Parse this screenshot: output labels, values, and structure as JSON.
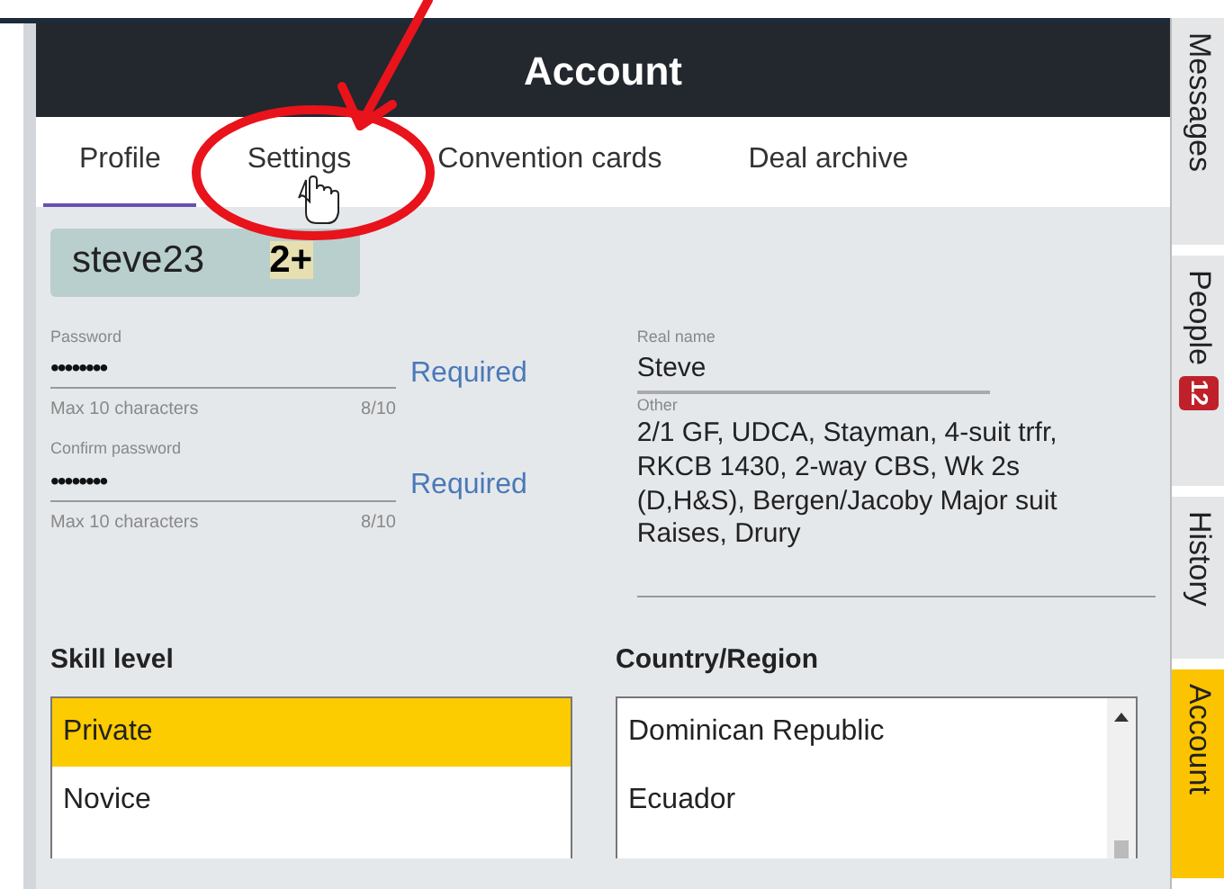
{
  "header": {
    "title": "Account"
  },
  "tabs": [
    {
      "label": "Profile",
      "selected": true
    },
    {
      "label": "Settings",
      "selected": false
    },
    {
      "label": "Convention cards",
      "selected": false
    },
    {
      "label": "Deal archive",
      "selected": false
    }
  ],
  "user": {
    "username": "steve23",
    "rank": "2+"
  },
  "password_fields": [
    {
      "label": "Password",
      "value": "••••••••",
      "hint": "Max 10 characters",
      "counter": "8/10",
      "status": "Required"
    },
    {
      "label": "Confirm password",
      "value": "••••••••",
      "hint": "Max 10 characters",
      "counter": "8/10",
      "status": "Required"
    }
  ],
  "real_name": {
    "label": "Real name",
    "value": "Steve"
  },
  "other": {
    "label": "Other",
    "value": "2/1 GF, UDCA, Stayman, 4-suit trfr, RKCB 1430, 2-way CBS, Wk 2s (D,H&S), Bergen/Jacoby Major suit Raises, Drury"
  },
  "skill_level": {
    "label": "Skill level",
    "options": [
      {
        "label": "Private",
        "selected": true
      },
      {
        "label": "Novice",
        "selected": false
      }
    ]
  },
  "country": {
    "label": "Country/Region",
    "options": [
      {
        "label": "Dominican Republic",
        "selected": false
      },
      {
        "label": "Ecuador",
        "selected": false
      }
    ]
  },
  "side_tabs": [
    {
      "label": "Messages",
      "selected": false
    },
    {
      "label": "People",
      "badge": "12",
      "selected": false
    },
    {
      "label": "History",
      "selected": false
    },
    {
      "label": "Account",
      "selected": true
    }
  ]
}
